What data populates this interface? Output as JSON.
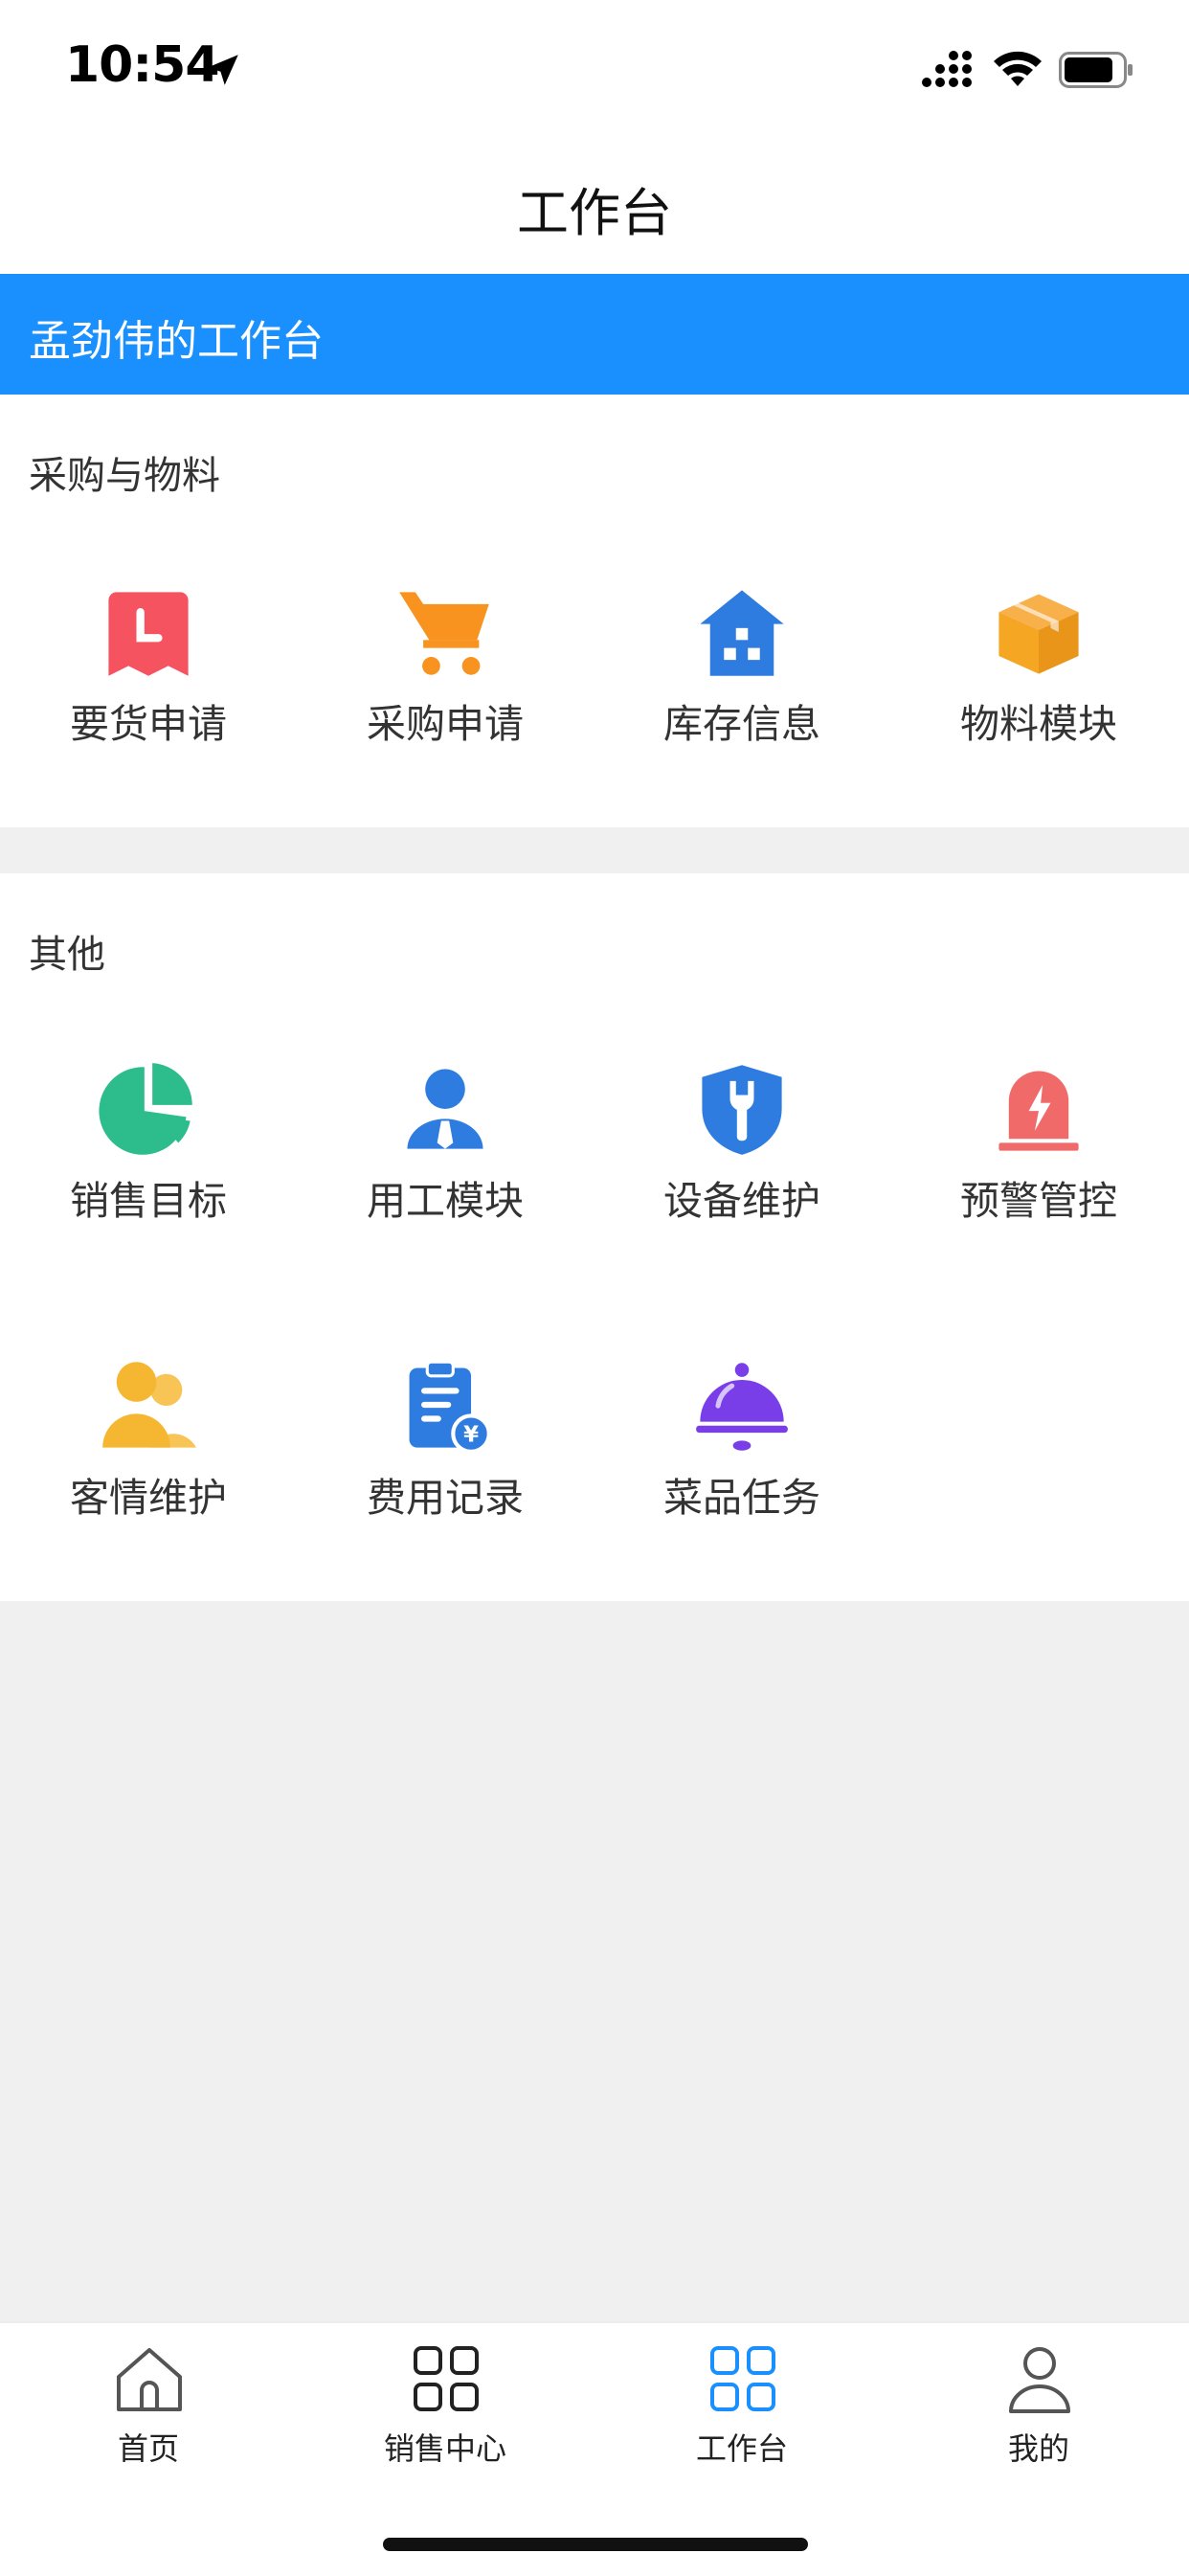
{
  "status_bar": {
    "time": "10:54"
  },
  "nav": {
    "title": "工作台"
  },
  "banner": {
    "title": "孟劲伟的工作台"
  },
  "sections": [
    {
      "title": "采购与物料",
      "items": [
        {
          "label": "要货申请",
          "icon": "bookmark-clock-icon",
          "color": "#f5535f"
        },
        {
          "label": "采购申请",
          "icon": "shopping-cart-icon",
          "color": "#f7931e"
        },
        {
          "label": "库存信息",
          "icon": "warehouse-icon",
          "color": "#2e7ce0"
        },
        {
          "label": "物料模块",
          "icon": "box-icon",
          "color": "#f5a623"
        }
      ]
    },
    {
      "title": "其他",
      "items": [
        {
          "label": "销售目标",
          "icon": "pie-chart-icon",
          "color": "#2dbd8c"
        },
        {
          "label": "用工模块",
          "icon": "worker-icon",
          "color": "#2e7ce0"
        },
        {
          "label": "设备维护",
          "icon": "shield-wrench-icon",
          "color": "#2e7ce0"
        },
        {
          "label": "预警管控",
          "icon": "alarm-light-icon",
          "color": "#f06a6a"
        },
        {
          "label": "客情维护",
          "icon": "customers-icon",
          "color": "#f5b731"
        },
        {
          "label": "费用记录",
          "icon": "expense-clipboard-icon",
          "color": "#2e7ce0"
        },
        {
          "label": "菜品任务",
          "icon": "food-cloche-icon",
          "color": "#7a3ee8"
        }
      ]
    }
  ],
  "tabbar": [
    {
      "label": "首页",
      "icon": "home-icon",
      "active": false
    },
    {
      "label": "销售中心",
      "icon": "grid-icon",
      "active": false
    },
    {
      "label": "工作台",
      "icon": "grid-icon",
      "active": true
    },
    {
      "label": "我的",
      "icon": "user-icon",
      "active": false
    }
  ],
  "colors": {
    "primary": "#1a90ff",
    "background": "#f0f0f0"
  }
}
